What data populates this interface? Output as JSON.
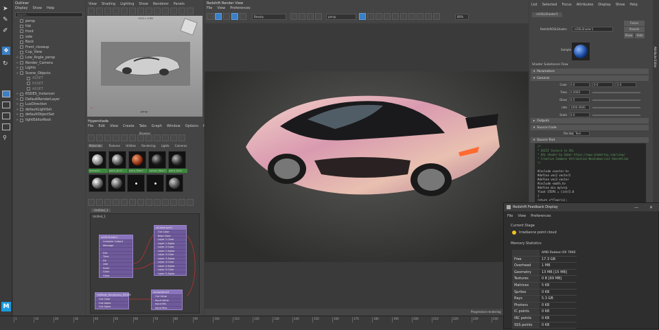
{
  "outliner": {
    "title": "Outliner",
    "menu": [
      "Display",
      "Show",
      "Help"
    ],
    "search_placeholder": "Search...",
    "items": [
      {
        "label": "persp",
        "dim": false
      },
      {
        "label": "top",
        "dim": false
      },
      {
        "label": "front",
        "dim": false
      },
      {
        "label": "side",
        "dim": false
      },
      {
        "label": "Back",
        "dim": false
      },
      {
        "label": "Front_closeup",
        "dim": false
      },
      {
        "label": "Cup_View",
        "dim": false
      },
      {
        "label": "Low_Angle_persp",
        "dim": false
      },
      {
        "label": "Render_Camera",
        "dim": false
      },
      {
        "label": "Lights",
        "dim": false
      },
      {
        "label": "Scene_Objects",
        "dim": false
      },
      {
        "label": "ASSET",
        "dim": true
      },
      {
        "label": "RSSET",
        "dim": true
      },
      {
        "label": "ASSET",
        "dim": true
      },
      {
        "label": "RSDES_Instancer",
        "dim": false
      },
      {
        "label": "DefaultRenderLayer",
        "dim": false
      },
      {
        "label": "LuxDirection",
        "dim": false
      },
      {
        "label": "defaultLightSet",
        "dim": false
      },
      {
        "label": "defaultObjectSet",
        "dim": false
      },
      {
        "label": "lightEditorRoot",
        "dim": false
      }
    ]
  },
  "viewport": {
    "menu": [
      "View",
      "Shading",
      "Lighting",
      "Show",
      "Renderer",
      "Panels"
    ],
    "label": "persp",
    "top_label": "1920 x 1080"
  },
  "hypershade": {
    "title": "Hypershade",
    "menu": [
      "File",
      "Edit",
      "View",
      "Create",
      "Tabs",
      "Graph",
      "Window",
      "Options",
      "Help"
    ],
    "browser_label": "Browser",
    "tabs": [
      "Materials",
      "Textures",
      "Utilities",
      "Rendering",
      "Lights",
      "Cameras"
    ],
    "materials": [
      "lambert1",
      "paint_Dirt1",
      "paint_Redr1",
      "carbon_fiber1",
      "paint_Dark"
    ],
    "graph_tab": "Untitled_1",
    "graph_label": "Unitled_1",
    "node1": {
      "title": "rsOSLShader1",
      "ports": [
        "Compiler Output",
        "Message",
        "",
        "Dirt",
        "Time",
        "Dir",
        "rate",
        "Scale",
        "Color",
        "Gloss"
      ]
    },
    "node2": {
      "title": "rsColorLayer1",
      "ports": [
        "Out Color",
        "Base Color",
        "Layer 1 Color",
        "Layer 1 Alpha",
        "Layer 2 Color",
        "Layer 2 Alpha",
        "Layer 3 Color",
        "Layer 3 Alpha",
        "Layer 4 Color",
        "Layer 4 Alpha",
        "Layer 5 Color",
        "Layer 5 Alpha"
      ]
    },
    "node3": {
      "title": "GetBody_Roughness_RSDSR",
      "ports": [
        "Out Color",
        "Out Alpha",
        "Out Alpha"
      ]
    },
    "node4": {
      "title": "remapValue3",
      "ports": [
        "Out Value",
        "Input Value",
        "Input Min",
        "Input Max"
      ]
    }
  },
  "render_view": {
    "title": "Redshift Render View",
    "menu": [
      "File",
      "View",
      "Preferences"
    ],
    "camera": "persp",
    "aov": "Beauty",
    "zoom": "80%",
    "status": "Progressive rendering"
  },
  "attribute_editor": {
    "menu": [
      "List",
      "Selected",
      "Focus",
      "Attributes",
      "Display",
      "Show",
      "Help"
    ],
    "tab": "rsOSLShader1",
    "shader_label": "RedshiftOSLShader:",
    "shader_value": "rsOSLShader1",
    "buttons": [
      "Focus",
      "Presets",
      "Show",
      "Hide"
    ],
    "sample_label": "Sample",
    "section_title": "Shader Substance Flow",
    "sections": [
      "Parameters",
      "General"
    ],
    "params": [
      {
        "label": "Color",
        "a": "0.0",
        "b": "0.0",
        "c": "0.0"
      },
      {
        "label": "Time",
        "a": "0.0000",
        "b": "",
        "c": ""
      },
      {
        "label": "Gloss",
        "a": "0.5",
        "b": "",
        "c": ""
      },
      {
        "label": "rate",
        "a": "1000.0000",
        "b": "",
        "c": ""
      },
      {
        "label": "Scale",
        "a": "6.0",
        "b": "",
        "c": ""
      }
    ],
    "outputs": "Outputs",
    "source_code": "Source Code",
    "file_label": "File Source",
    "file_value": "Text",
    "source_text": "Source Text",
    "code": [
      "/*",
      "  * ASCII texture in OSL",
      "  * OSL shader by Saber https://www.shadertoy.com/view/",
      "  * Creative Commons Attribution-NonCommercial-ShareAlike",
      "  */",
      "",
      "#include <vector.h>",
      "#define vec2 vector2",
      "#define vec3 vector",
      "#include <math.h>",
      "#define mix mylerp",
      "float STEPS = (int)5.0",
      "{",
      "  return x*floor(x);",
      "}",
      "",
      "vec mandel(vec2 c)"
    ]
  },
  "side_tab": "Attribute Editor",
  "feedback": {
    "title": "Redshift Feedback Display",
    "menu": [
      "File",
      "View",
      "Preferences"
    ],
    "current_stage_label": "Current Stage",
    "current_stage": "Irradiance point cloud",
    "memory_label": "Memory Statistics",
    "gpu": "AMD Radeon RX 7900 XT",
    "stats": [
      {
        "k": "Free",
        "v": "17.3 GB"
      },
      {
        "k": "Overhead",
        "v": "1 MB"
      },
      {
        "k": "Geometry",
        "v": "13 MB [15 MB]"
      },
      {
        "k": "Textures",
        "v": "0 B [69 MB]"
      },
      {
        "k": "Matrices",
        "v": "5 KB"
      },
      {
        "k": "Sprites",
        "v": "0 KB"
      },
      {
        "k": "Rays",
        "v": "5.3 GB"
      },
      {
        "k": "Photons",
        "v": "0 KB"
      },
      {
        "k": "IC points",
        "v": "0 KB"
      },
      {
        "k": "IRC points",
        "v": "0 KB"
      },
      {
        "k": "SSS points",
        "v": "0 KB"
      }
    ]
  },
  "timeline": {
    "ticks": [
      "1",
      "10",
      "20",
      "30",
      "40",
      "50",
      "60",
      "70",
      "80",
      "90",
      "100",
      "110",
      "120",
      "130",
      "140",
      "150",
      "160",
      "170",
      "180",
      "190",
      "200",
      "210",
      "220",
      "230",
      "240"
    ]
  },
  "colors": {
    "accent": "#3b7fc4",
    "node": "#6e5a9a",
    "wire": "#c03030",
    "stage_dot": "#f0c020"
  }
}
